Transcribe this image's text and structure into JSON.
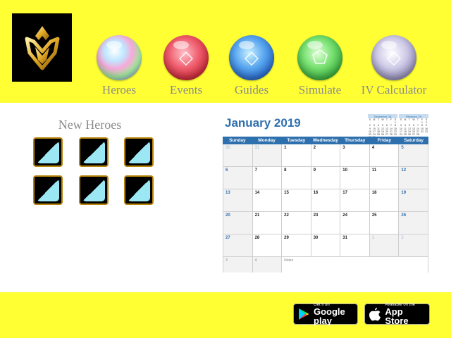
{
  "header": {
    "logo_icon": "gold-crest-emblem",
    "nav": [
      {
        "label": "Heroes",
        "icon": "rainbow-orb",
        "color": "#d9e0ff"
      },
      {
        "label": "Events",
        "icon": "red-orb",
        "color": "#e0505f"
      },
      {
        "label": "Guides",
        "icon": "blue-orb",
        "color": "#3c7be0"
      },
      {
        "label": "Simulate",
        "icon": "green-orb",
        "color": "#4cd15c"
      },
      {
        "label": "IV Calculator",
        "icon": "grey-orb",
        "color": "#a8a3c8"
      }
    ]
  },
  "new_heroes": {
    "title": "New Heroes",
    "count": 6
  },
  "calendar": {
    "title": "January 2019",
    "mini_prev": {
      "title": "December '18",
      "days_header": [
        "S",
        "M",
        "T",
        "W",
        "T",
        "F",
        "S"
      ],
      "weeks": [
        [
          "",
          "",
          "",
          "",
          "",
          "",
          "1"
        ],
        [
          "2",
          "3",
          "4",
          "5",
          "6",
          "7",
          "8"
        ],
        [
          "9",
          "10",
          "11",
          "12",
          "13",
          "14",
          "15"
        ],
        [
          "16",
          "17",
          "18",
          "19",
          "20",
          "21",
          "22"
        ],
        [
          "23",
          "24",
          "25",
          "26",
          "27",
          "28",
          "29"
        ],
        [
          "30",
          "31",
          "",
          "",
          "",
          "",
          ""
        ]
      ]
    },
    "mini_next": {
      "title": "February '19",
      "days_header": [
        "S",
        "M",
        "T",
        "W",
        "T",
        "F",
        "S"
      ],
      "weeks": [
        [
          "",
          "",
          "",
          "",
          "",
          "1",
          "2"
        ],
        [
          "3",
          "4",
          "5",
          "6",
          "7",
          "8",
          "9"
        ],
        [
          "10",
          "11",
          "12",
          "13",
          "14",
          "15",
          "16"
        ],
        [
          "17",
          "18",
          "19",
          "20",
          "21",
          "22",
          "23"
        ],
        [
          "24",
          "25",
          "26",
          "27",
          "28",
          "",
          ""
        ]
      ]
    },
    "weekdays": [
      "Sunday",
      "Monday",
      "Tuesday",
      "Wednesday",
      "Thursday",
      "Friday",
      "Saturday"
    ],
    "weeks": [
      [
        "30",
        "31",
        "1",
        "2",
        "3",
        "4",
        "5"
      ],
      [
        "6",
        "7",
        "8",
        "9",
        "10",
        "11",
        "12"
      ],
      [
        "13",
        "14",
        "15",
        "16",
        "17",
        "18",
        "19"
      ],
      [
        "20",
        "21",
        "22",
        "23",
        "24",
        "25",
        "26"
      ],
      [
        "27",
        "28",
        "29",
        "30",
        "31",
        "1",
        "2"
      ]
    ],
    "notes_row": {
      "c1": "3",
      "c2": "4",
      "notes_label": "Notes"
    },
    "accent": "#2e6fae"
  },
  "footer": {
    "google_play": {
      "small": "Get it on",
      "big": "Google play"
    },
    "app_store": {
      "small": "Available on the",
      "big": "App Store"
    }
  }
}
